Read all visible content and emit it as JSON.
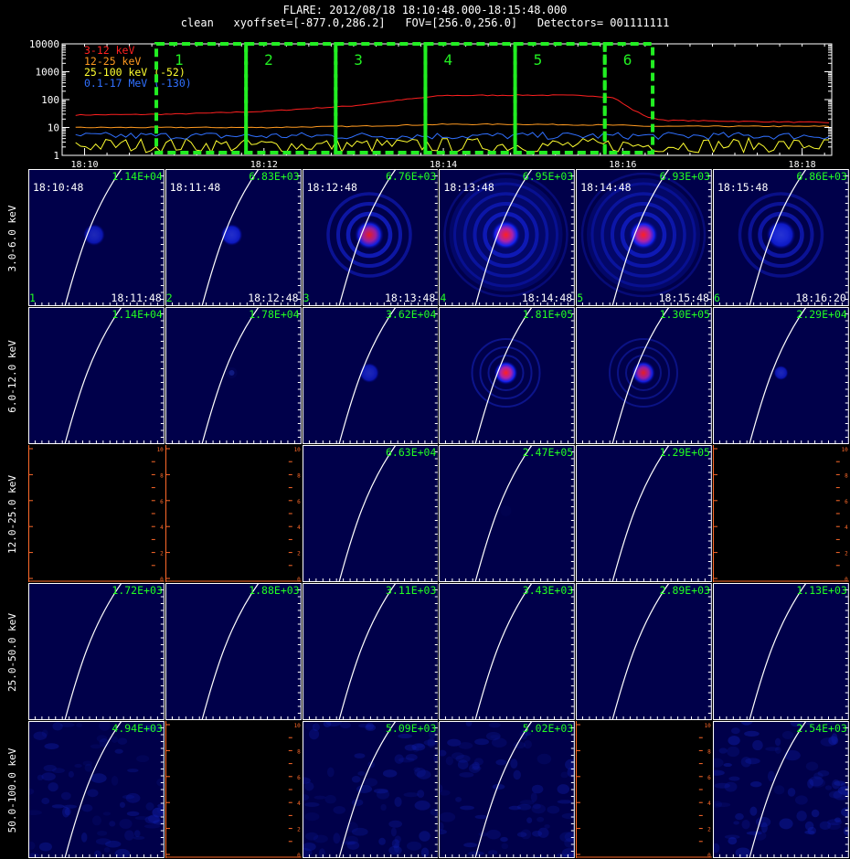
{
  "header": {
    "line1": "FLARE: 2012/08/18 18:10:48.000-18:15:48.000",
    "line2": "clean   xyoffset=[-877.0,286.2]   FOV=[256.0,256.0]   Detectors= 001111111"
  },
  "lightcurve": {
    "type": "line",
    "y_scale": "log",
    "ylim": [
      1,
      10000
    ],
    "y_ticks": [
      "10000",
      "1000",
      "100",
      "10",
      "1"
    ],
    "x_ticks": [
      "18:10",
      "18:12",
      "18:14",
      "18:16",
      "18:18"
    ],
    "legend_position": "top-left",
    "series": [
      {
        "name": "3-12 keV",
        "color": "#ff2020",
        "t": [
          9.9,
          11.0,
          12.0,
          12.5,
          13.0,
          13.5,
          14.0,
          15.0,
          15.6,
          15.9,
          16.1,
          16.3,
          16.5,
          18.3
        ],
        "y": [
          28,
          30,
          38,
          48,
          60,
          95,
          140,
          145,
          140,
          118,
          45,
          22,
          18,
          15
        ]
      },
      {
        "name": "12-25 keV",
        "color": "#ff9a20",
        "t": [
          9.9,
          12.0,
          13.0,
          14.0,
          15.0,
          16.0,
          16.3,
          18.3
        ],
        "y": [
          10,
          10,
          11,
          13,
          13,
          12,
          11,
          11
        ]
      },
      {
        "name": "25-100 keV (-52)",
        "color": "#ffff30",
        "t": [
          9.9,
          18.3
        ],
        "y": [
          2.3,
          2.3
        ]
      },
      {
        "name": "0.1-17 MeV (-130)",
        "color": "#3070ff",
        "t": [
          9.9,
          18.3
        ],
        "y": [
          5,
          5
        ]
      }
    ],
    "intervals": [
      {
        "label": "1",
        "start": "18:10:48",
        "end": "18:11:48"
      },
      {
        "label": "2",
        "start": "18:11:48",
        "end": "18:12:48"
      },
      {
        "label": "3",
        "start": "18:12:48",
        "end": "18:13:48"
      },
      {
        "label": "4",
        "start": "18:13:48",
        "end": "18:14:48"
      },
      {
        "label": "5",
        "start": "18:14:48",
        "end": "18:15:48"
      },
      {
        "label": "6",
        "start": "18:15:48",
        "end": "18:16:20"
      }
    ]
  },
  "image_grid": {
    "bands": [
      "3.0-6.0 keV",
      "6.0-12.0 keV",
      "12.0-25.0 keV",
      "25.0-50.0 keV",
      "50.0-100.0 keV"
    ],
    "columns": [
      {
        "start": "18:10:48",
        "end": "18:11:48",
        "index": "1"
      },
      {
        "start": "18:11:48",
        "end": "18:12:48",
        "index": "2"
      },
      {
        "start": "18:12:48",
        "end": "18:13:48",
        "index": "3"
      },
      {
        "start": "18:13:48",
        "end": "18:14:48",
        "index": "4"
      },
      {
        "start": "18:14:48",
        "end": "18:15:48",
        "index": "5"
      },
      {
        "start": "18:15:48",
        "end": "18:16:20",
        "index": "6"
      }
    ],
    "peaks": [
      [
        "1.14E+04",
        "6.83E+03",
        "6.76E+03",
        "6.95E+03",
        "6.93E+03",
        "6.86E+03"
      ],
      [
        "1.14E+04",
        "1.78E+04",
        "3.62E+04",
        "1.81E+05",
        "1.30E+05",
        "2.29E+04"
      ],
      [
        "",
        "",
        "6.63E+04",
        "2.47E+05",
        "1.29E+05",
        ""
      ],
      [
        "1.72E+03",
        "1.88E+03",
        "3.11E+03",
        "3.43E+03",
        "2.89E+03",
        "1.13E+03"
      ],
      [
        "4.94E+03",
        "",
        "5.09E+03",
        "5.02E+03",
        "",
        "2.54E+03"
      ]
    ],
    "empty_axis_ticks": [
      "10",
      "8",
      "6",
      "4",
      "2",
      "0"
    ],
    "styles": [
      [
        "blob",
        "blob",
        "blob-ring",
        "ring-big",
        "ring-big",
        "blob-ring"
      ],
      [
        "plain",
        "plain",
        "blob",
        "ring-small",
        "ring-small",
        "blob-small"
      ],
      [
        "empty",
        "empty",
        "plain",
        "plain",
        "plain",
        "empty"
      ],
      [
        "plain",
        "plain",
        "plain",
        "plain",
        "plain",
        "plain"
      ],
      [
        "noise",
        "empty",
        "noise",
        "noise",
        "empty",
        "noise"
      ]
    ],
    "intensity": [
      [
        0.55,
        0.7,
        0.9,
        1.0,
        1.0,
        0.75
      ],
      [
        0.0,
        0.1,
        0.6,
        1.0,
        0.9,
        0.45
      ],
      [
        0.0,
        0.0,
        0.0,
        0.05,
        0.0,
        0.0
      ],
      [
        0.0,
        0.0,
        0.0,
        0.0,
        0.0,
        0.0
      ],
      [
        0.5,
        0.0,
        0.5,
        0.5,
        0.0,
        0.6
      ]
    ]
  }
}
